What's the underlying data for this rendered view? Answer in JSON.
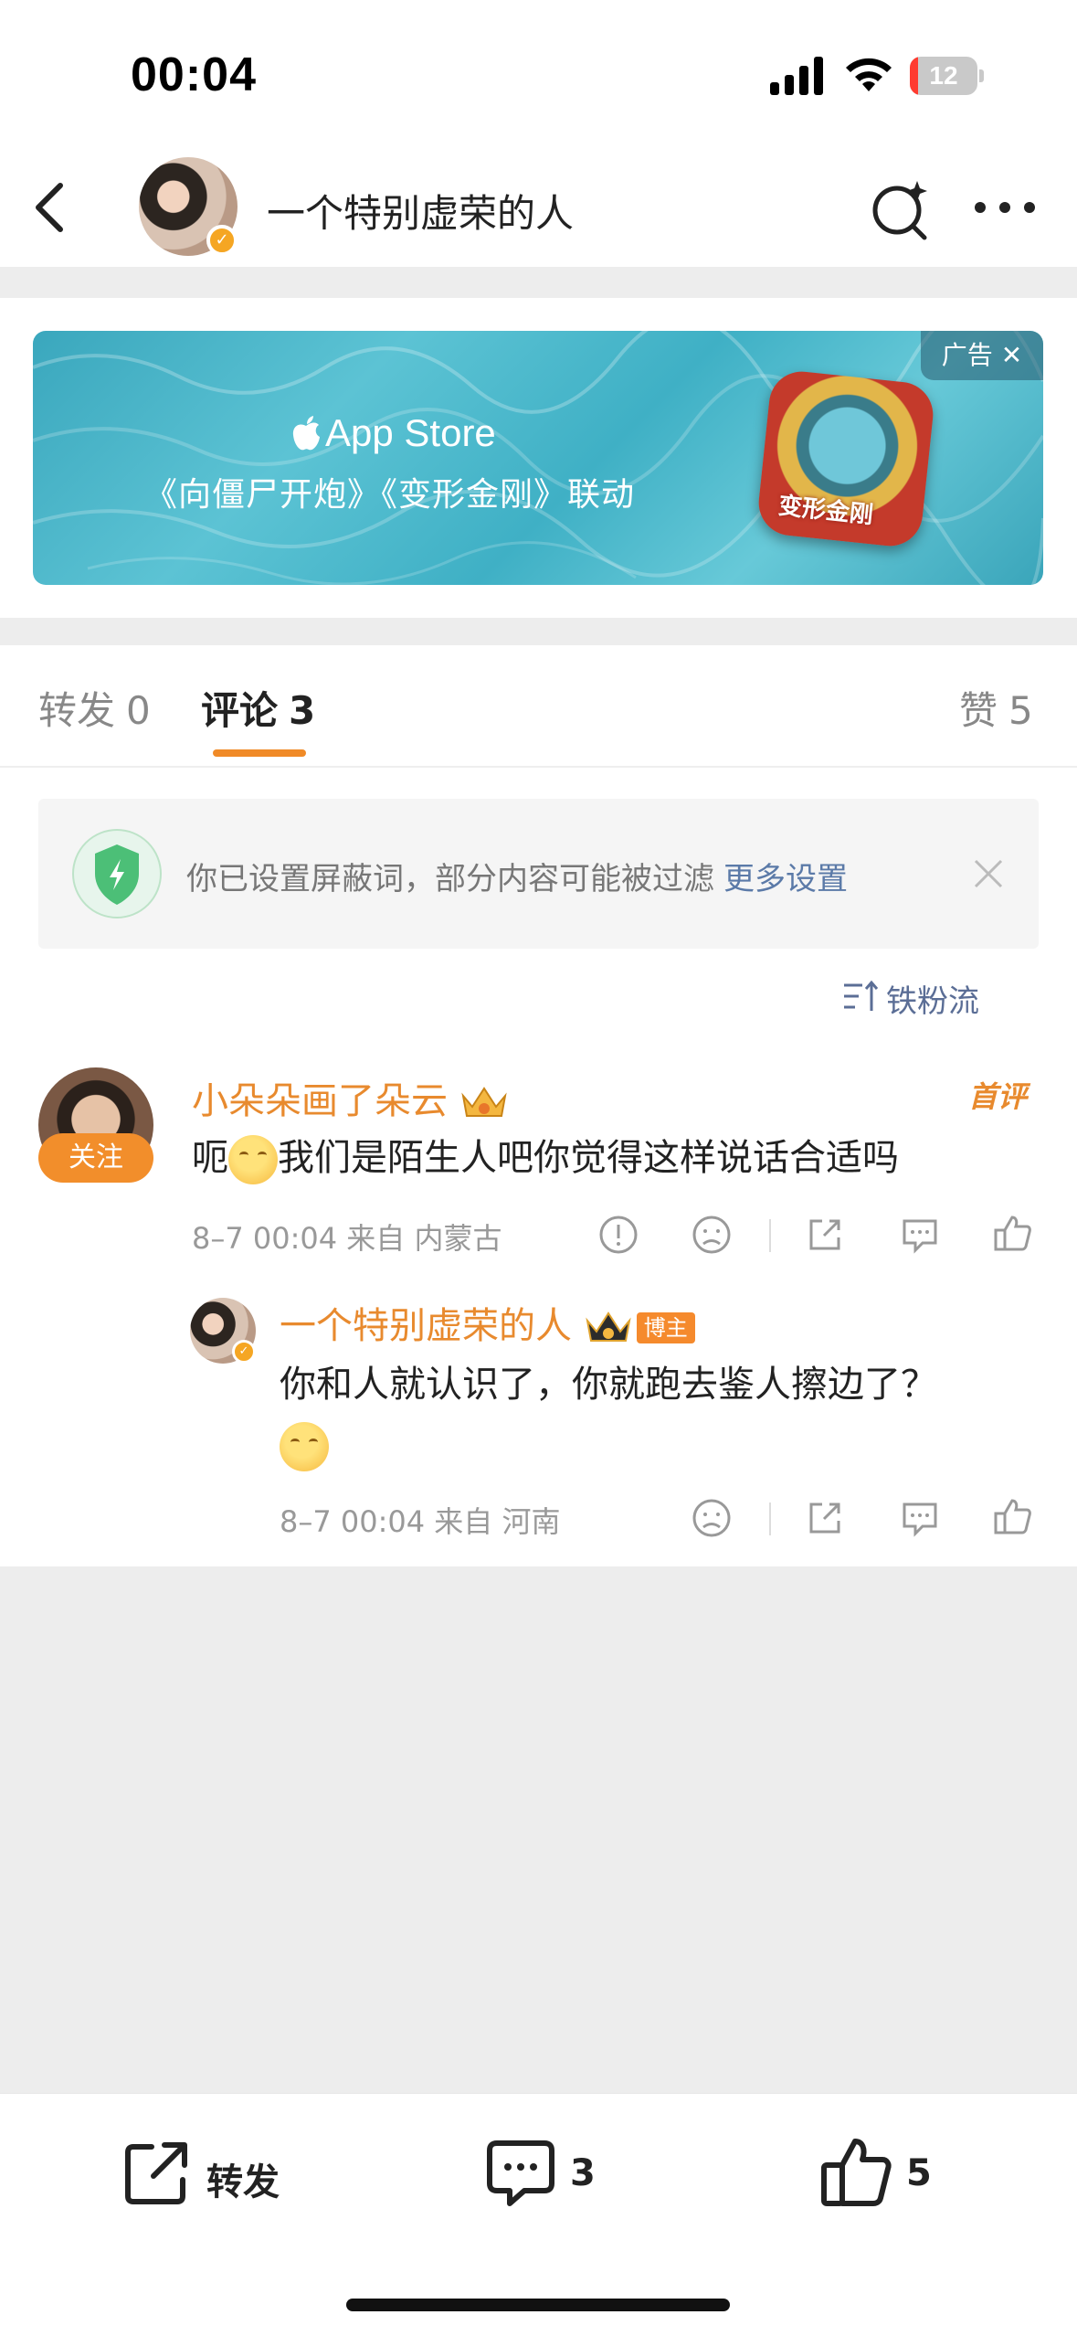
{
  "status_bar": {
    "time": "00:04",
    "battery": "12",
    "battery_level": 0.12,
    "battery_color": "#ff3b30"
  },
  "nav": {
    "title": "一个特别虚荣的人",
    "back_icon": "chevron-left-icon",
    "search_icon": "search-sparkle-icon",
    "more_icon": "more-dots-icon"
  },
  "ad": {
    "store": "App Store",
    "text": "《向僵尸开炮》《变形金刚》联动",
    "game_label": "变形金刚",
    "tag": "广告"
  },
  "tabs": {
    "repost": {
      "label": "转发",
      "count": "0"
    },
    "comment": {
      "label": "评论",
      "count": "3"
    },
    "like": {
      "label": "赞",
      "count": "5"
    }
  },
  "filter_notice": {
    "text": "你已设置屏蔽词，部分内容可能被过滤",
    "link": "更多设置"
  },
  "sort_label": "铁粉流",
  "comments": [
    {
      "name": "小朵朵画了朵云",
      "follow_label": "关注",
      "first_label": "首评",
      "text_before": "呃",
      "text_after": "我们是陌生人吧你觉得这样说话合适吗",
      "meta": "8–7 00:04  来自 内蒙古"
    },
    {
      "name": "一个特别虚荣的人",
      "badge": "博主",
      "text": "你和人就认识了，你就跑去鉴人擦边了？",
      "meta": "8–7 00:04  来自 河南"
    }
  ],
  "toolbar": {
    "repost_label": "转发",
    "comment_count": "3",
    "like_count": "5"
  },
  "colors": {
    "accent": "#f08a27",
    "link": "#5b7aa8",
    "name": "#e88a2e"
  }
}
